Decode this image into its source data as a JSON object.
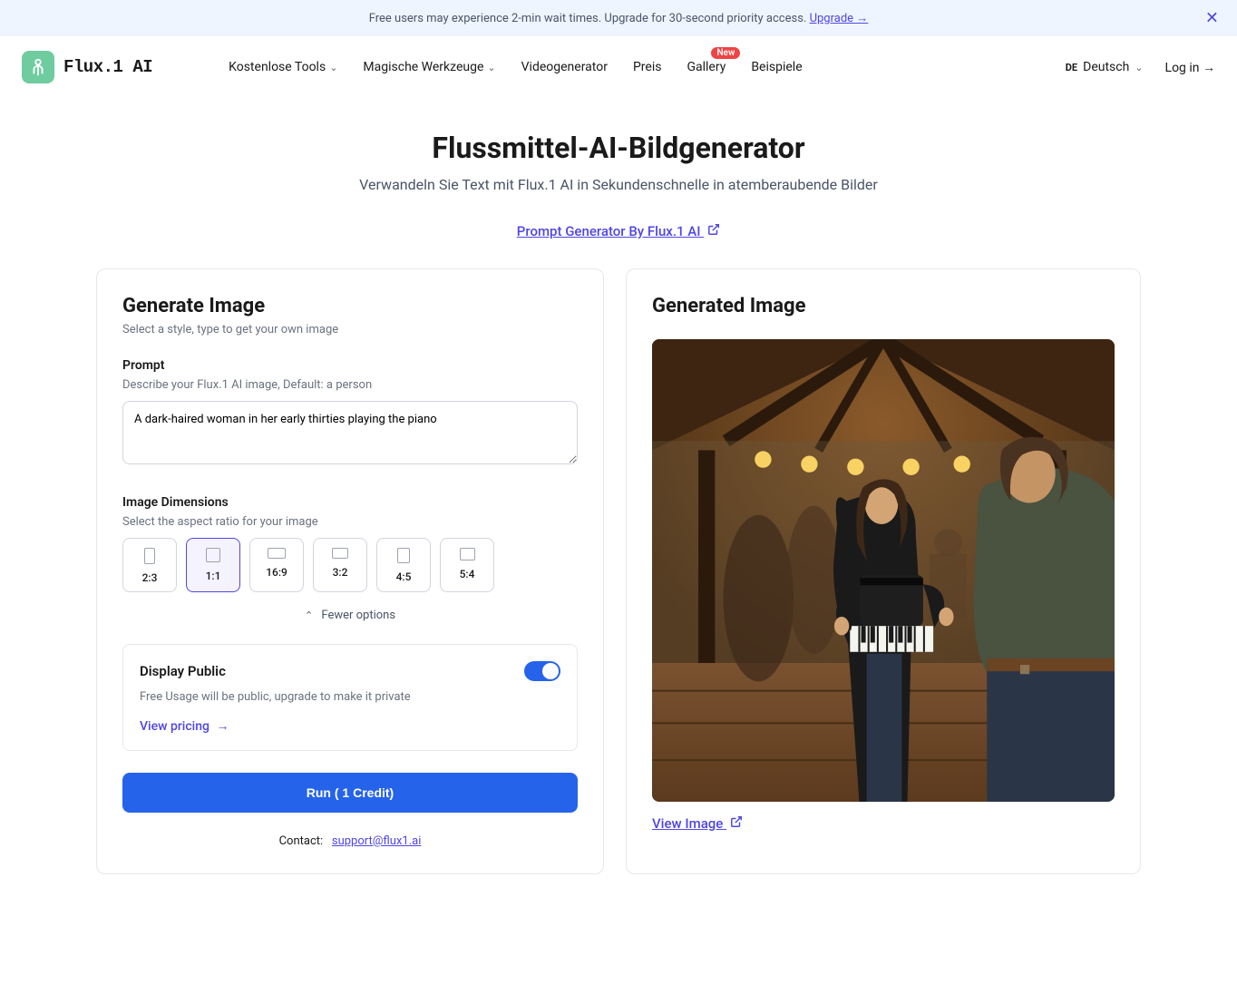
{
  "banner": {
    "text": "Free users may experience 2-min wait times. Upgrade for 30-second priority access. ",
    "upgrade_label": "Upgrade →"
  },
  "header": {
    "logo_text": "Flux.1 AI",
    "nav": {
      "tools": "Kostenlose Tools",
      "magic": "Magische Werkzeuge",
      "video": "Videogenerator",
      "price": "Preis",
      "gallery": "Gallery",
      "gallery_badge": "New",
      "examples": "Beispiele"
    },
    "lang_code": "DE",
    "lang_label": "Deutsch",
    "login": "Log in →"
  },
  "page": {
    "title": "Flussmittel-AI-Bildgenerator",
    "subtitle": "Verwandeln Sie Text mit Flux.1 AI in Sekundenschnelle in atemberaubende Bilder",
    "prompt_generator_link": "Prompt Generator By Flux.1 AI"
  },
  "generate": {
    "title": "Generate Image",
    "desc": "Select a style, type to get your own image",
    "prompt_label": "Prompt",
    "prompt_hint": "Describe your Flux.1 AI image, Default: a person",
    "prompt_value": "A dark-haired woman in her early thirties playing the piano",
    "dimensions_label": "Image Dimensions",
    "dimensions_hint": "Select the aspect ratio for your image",
    "ratios": [
      {
        "label": "2:3",
        "w": 12,
        "h": 18
      },
      {
        "label": "1:1",
        "w": 16,
        "h": 16
      },
      {
        "label": "16:9",
        "w": 20,
        "h": 12
      },
      {
        "label": "3:2",
        "w": 18,
        "h": 12
      },
      {
        "label": "4:5",
        "w": 14,
        "h": 17
      },
      {
        "label": "5:4",
        "w": 17,
        "h": 14
      }
    ],
    "selected_ratio": "1:1",
    "fewer_options": "Fewer options",
    "display_public_title": "Display Public",
    "display_public_text": "Free Usage will be public, upgrade to make it private",
    "view_pricing": "View pricing",
    "run_button": "Run   ( 1 Credit)",
    "contact_label": "Contact:",
    "contact_email": "support@flux1.ai"
  },
  "output": {
    "title": "Generated Image",
    "view_link": "View Image"
  }
}
